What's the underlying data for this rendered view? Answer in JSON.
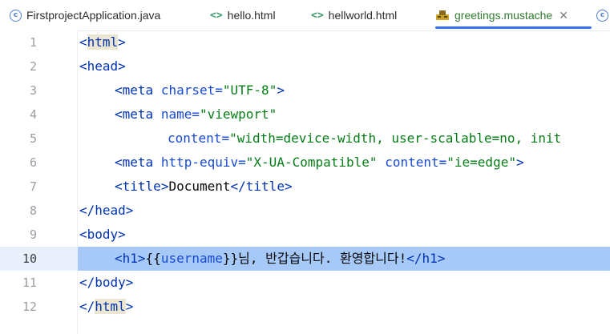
{
  "tabs": [
    {
      "label": "FirstprojectApplication.java",
      "icon": "java-class-icon"
    },
    {
      "label": "hello.html",
      "icon": "html-icon"
    },
    {
      "label": "hellworld.html",
      "icon": "html-icon"
    },
    {
      "label": "greetings.mustache",
      "icon": "mustache-icon",
      "active": true
    },
    {
      "label": "",
      "icon": "java-class-icon"
    }
  ],
  "editor": {
    "current_line": 10,
    "lines": [
      {
        "num": "1"
      },
      {
        "num": "2"
      },
      {
        "num": "3"
      },
      {
        "num": "4"
      },
      {
        "num": "5"
      },
      {
        "num": "6"
      },
      {
        "num": "7"
      },
      {
        "num": "8"
      },
      {
        "num": "9"
      },
      {
        "num": "10"
      },
      {
        "num": "11"
      },
      {
        "num": "12"
      }
    ],
    "tokens": {
      "l1": [
        "<",
        "html",
        ">"
      ],
      "l2": [
        "<",
        "head",
        ">"
      ],
      "l3": [
        "<",
        "meta",
        " ",
        "charset",
        "=",
        "\"UTF-8\"",
        ">"
      ],
      "l4": [
        "<",
        "meta",
        " ",
        "name",
        "=",
        "\"viewport\""
      ],
      "l5": [
        "content",
        "=",
        "\"width=device-width, user-scalable=no, init"
      ],
      "l6": [
        "<",
        "meta",
        " ",
        "http-equiv",
        "=",
        "\"X-UA-Compatible\"",
        " ",
        "content",
        "=",
        "\"ie=edge\"",
        ">"
      ],
      "l7": [
        "<",
        "title",
        ">",
        "Document",
        "</",
        "title",
        ">"
      ],
      "l8": [
        "</",
        "head",
        ">"
      ],
      "l9": [
        "<",
        "body",
        ">"
      ],
      "l10": [
        "<",
        "h1",
        ">",
        "{{",
        "username",
        "}}",
        "님, 반갑습니다. 환영합니다!",
        "</",
        "h1",
        ">"
      ],
      "l11": [
        "</",
        "body",
        ">"
      ],
      "l12": [
        "</",
        "html",
        ">"
      ]
    }
  },
  "colors": {
    "tag": "#0033b3",
    "attribute": "#174ad4",
    "string": "#067d17",
    "selection": "#a6c9f7",
    "active_tab_underline": "#3574f0"
  }
}
